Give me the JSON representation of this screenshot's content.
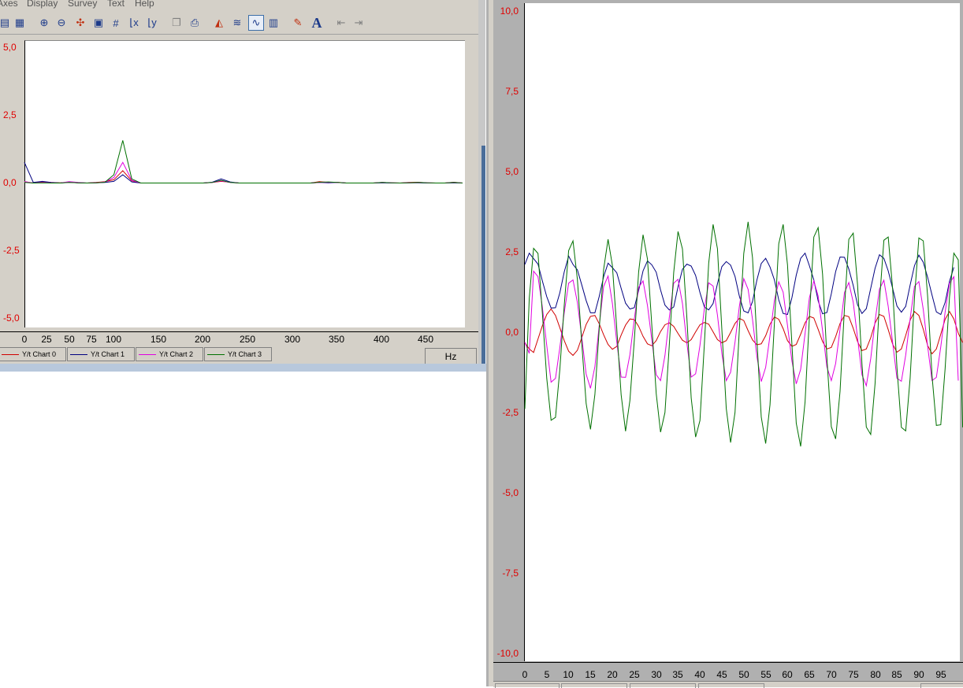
{
  "menu": {
    "items": [
      "Axes",
      "Display",
      "Survey",
      "Text",
      "Help"
    ]
  },
  "toolbar": {
    "icons": [
      "chart-list-icon",
      "table-icon",
      "zoom-in-icon",
      "zoom-out-icon",
      "cursor-icon",
      "save-icon",
      "grid-icon",
      "x-scale-icon",
      "y-scale-icon",
      "copy-icon",
      "print-icon",
      "fill-chart-icon",
      "wave-chart-icon",
      "line-chart-icon",
      "bar-chart-icon",
      "paint-brush-icon",
      "text-icon",
      "arrow-left-icon",
      "arrow-right-icon"
    ],
    "text_glyph": "A"
  },
  "colors": {
    "series0": "#d00000",
    "series1": "#000080",
    "series2": "#e000e0",
    "series3": "#007000",
    "axis_label": "#e00000"
  },
  "legend": [
    {
      "label": "Y/t Chart 0",
      "color": "#d00000"
    },
    {
      "label": "Y/t Chart 1",
      "color": "#000080"
    },
    {
      "label": "Y/t Chart 2",
      "color": "#e000e0"
    },
    {
      "label": "Y/t Chart 3",
      "color": "#007000"
    }
  ],
  "unit_box": "Hz",
  "left_axis": {
    "y_ticks": [
      "5,0",
      "2,5",
      "0,0",
      "-2,5",
      "-5,0"
    ],
    "x_ticks": [
      "0",
      "25",
      "50",
      "75",
      "100",
      "150",
      "200",
      "250",
      "300",
      "350",
      "400",
      "450"
    ]
  },
  "right_axis": {
    "y_ticks": [
      "10,0",
      "7,5",
      "5,0",
      "2,5",
      "0,0",
      "-2,5",
      "-5,0",
      "-7,5",
      "-10,0"
    ],
    "x_ticks": [
      "0",
      "5",
      "10",
      "15",
      "20",
      "25",
      "30",
      "35",
      "40",
      "45",
      "50",
      "55",
      "60",
      "65",
      "70",
      "75",
      "80",
      "85",
      "90",
      "95"
    ]
  },
  "chart_data": [
    {
      "type": "line",
      "xlim": [
        0,
        490
      ],
      "ylim": [
        -5.2,
        5.2
      ],
      "x": [
        0,
        10,
        20,
        30,
        40,
        50,
        60,
        70,
        80,
        90,
        100,
        110,
        120,
        130,
        140,
        150,
        160,
        170,
        180,
        190,
        200,
        210,
        220,
        230,
        240,
        250,
        260,
        270,
        280,
        290,
        300,
        310,
        320,
        330,
        340,
        350,
        360,
        370,
        380,
        390,
        400,
        410,
        420,
        430,
        440,
        450,
        460,
        470,
        480,
        490
      ],
      "series": [
        {
          "name": "Y/t Chart 0",
          "color": "#d00000",
          "values": [
            0.05,
            0.0,
            0.04,
            0.02,
            0.01,
            0.03,
            0.01,
            0.0,
            0.02,
            0.05,
            0.12,
            0.45,
            0.08,
            0.0,
            0.0,
            0.0,
            0.0,
            0.0,
            0.0,
            0.0,
            0.0,
            0.02,
            0.06,
            0.03,
            0.0,
            0.0,
            0.0,
            0.0,
            0.0,
            0.0,
            0.0,
            0.0,
            0.0,
            0.05,
            0.02,
            0.03,
            0.0,
            0.0,
            0.0,
            0.0,
            0.02,
            0.01,
            0.0,
            0.02,
            0.03,
            0.01,
            0.0,
            0.0,
            0.03,
            0.0
          ]
        },
        {
          "name": "Y/t Chart 1",
          "color": "#000080",
          "values": [
            0.75,
            0.02,
            0.06,
            0.02,
            0.0,
            0.03,
            0.01,
            0.0,
            0.01,
            0.02,
            0.06,
            0.3,
            0.04,
            0.0,
            0.0,
            0.0,
            0.0,
            0.0,
            0.0,
            0.0,
            0.0,
            0.03,
            0.15,
            0.04,
            0.0,
            0.0,
            0.0,
            0.0,
            0.0,
            0.0,
            0.0,
            0.0,
            0.0,
            0.02,
            0.01,
            0.02,
            0.0,
            0.0,
            0.0,
            0.0,
            0.01,
            0.0,
            0.0,
            0.01,
            0.01,
            0.0,
            0.0,
            0.0,
            0.01,
            0.0
          ]
        },
        {
          "name": "Y/t Chart 2",
          "color": "#e000e0",
          "values": [
            0.05,
            0.0,
            0.02,
            0.01,
            0.0,
            0.05,
            0.02,
            0.0,
            0.01,
            0.04,
            0.2,
            0.75,
            0.1,
            0.0,
            0.0,
            0.0,
            0.0,
            0.0,
            0.0,
            0.0,
            0.0,
            0.02,
            0.08,
            0.02,
            0.0,
            0.0,
            0.0,
            0.0,
            0.0,
            0.0,
            0.0,
            0.0,
            0.0,
            0.02,
            0.03,
            0.02,
            0.0,
            0.0,
            0.0,
            0.0,
            0.02,
            0.01,
            0.0,
            0.01,
            0.02,
            0.01,
            0.0,
            0.0,
            0.02,
            0.0
          ]
        },
        {
          "name": "Y/t Chart 3",
          "color": "#007000",
          "values": [
            0.02,
            0.0,
            0.01,
            0.0,
            0.0,
            0.02,
            0.01,
            0.0,
            0.01,
            0.03,
            0.3,
            1.55,
            0.15,
            0.0,
            0.0,
            0.0,
            0.0,
            0.0,
            0.0,
            0.0,
            0.0,
            0.02,
            0.1,
            0.02,
            0.0,
            0.0,
            0.0,
            0.0,
            0.0,
            0.0,
            0.0,
            0.0,
            0.0,
            0.03,
            0.04,
            0.02,
            0.0,
            0.0,
            0.0,
            0.0,
            0.02,
            0.01,
            0.0,
            0.01,
            0.02,
            0.01,
            0.0,
            0.0,
            0.02,
            0.0
          ]
        }
      ]
    },
    {
      "type": "line",
      "xlim": [
        0,
        99
      ],
      "ylim": [
        -10.2,
        10.2
      ],
      "x_start": 0,
      "x_step": 1,
      "series": [
        {
          "name": "Y/t Chart 0",
          "color": "#d00000",
          "values": [
            -0.33,
            -0.52,
            -0.63,
            -0.21,
            0.2,
            0.55,
            0.72,
            0.52,
            0.14,
            -0.26,
            -0.59,
            -0.72,
            -0.56,
            -0.17,
            0.24,
            0.49,
            0.52,
            0.26,
            -0.08,
            -0.38,
            -0.53,
            -0.44,
            -0.09,
            0.22,
            0.41,
            0.39,
            0.18,
            -0.13,
            -0.36,
            -0.42,
            -0.26,
            0.02,
            0.23,
            0.29,
            0.18,
            -0.04,
            -0.25,
            -0.33,
            -0.23,
            0.01,
            0.23,
            0.3,
            0.25,
            0.01,
            -0.23,
            -0.33,
            -0.26,
            -0.01,
            0.27,
            0.43,
            0.36,
            0.05,
            -0.24,
            -0.39,
            -0.36,
            -0.11,
            0.25,
            0.47,
            0.4,
            0.11,
            -0.26,
            -0.44,
            -0.38,
            -0.06,
            0.29,
            0.49,
            0.44,
            0.09,
            -0.29,
            -0.52,
            -0.47,
            -0.14,
            0.27,
            0.52,
            0.48,
            0.12,
            -0.29,
            -0.57,
            -0.52,
            -0.17,
            0.28,
            0.55,
            0.49,
            0.08,
            -0.37,
            -0.62,
            -0.52,
            -0.1,
            0.37,
            0.64,
            0.52,
            0.09,
            -0.41,
            -0.67,
            -0.52,
            -0.06,
            0.4,
            0.64,
            0.41,
            -0.03,
            -0.32
          ]
        },
        {
          "name": "Y/t Chart 1",
          "color": "#000080",
          "values": [
            2.1,
            2.45,
            2.28,
            2.11,
            1.59,
            1.1,
            0.75,
            0.76,
            1.22,
            1.87,
            2.36,
            2.1,
            1.93,
            1.47,
            0.98,
            0.6,
            0.6,
            1.11,
            1.72,
            2.14,
            2.0,
            1.84,
            1.36,
            0.9,
            0.72,
            0.76,
            1.29,
            1.9,
            2.21,
            2.09,
            1.86,
            1.31,
            0.84,
            0.69,
            0.78,
            1.41,
            1.95,
            2.11,
            2.05,
            1.76,
            1.23,
            0.78,
            0.69,
            0.89,
            1.5,
            2.03,
            2.19,
            2.08,
            1.73,
            1.12,
            0.66,
            0.6,
            0.95,
            1.61,
            2.13,
            2.29,
            2.02,
            1.62,
            1.0,
            0.58,
            0.55,
            1.07,
            1.77,
            2.29,
            2.45,
            2.06,
            1.62,
            0.97,
            0.57,
            0.61,
            1.19,
            1.88,
            2.33,
            2.32,
            1.96,
            1.45,
            0.85,
            0.58,
            0.73,
            1.36,
            1.98,
            2.4,
            2.29,
            1.9,
            1.36,
            0.81,
            0.62,
            0.8,
            1.46,
            2.06,
            2.39,
            2.17,
            1.7,
            1.15,
            0.63,
            0.55,
            0.92,
            1.58,
            2.01
          ]
        },
        {
          "name": "Y/t Chart 2",
          "color": "#e000e0",
          "values": [
            -0.31,
            -0.66,
            1.89,
            1.72,
            0.78,
            -0.41,
            -1.55,
            -1.43,
            -0.48,
            0.61,
            1.52,
            1.62,
            0.92,
            -0.15,
            -1.3,
            -1.74,
            -1.07,
            0.21,
            1.42,
            1.74,
            0.89,
            -0.31,
            -1.39,
            -1.4,
            -0.7,
            0.4,
            1.39,
            1.59,
            0.83,
            -0.23,
            -1.32,
            -1.5,
            -0.72,
            0.45,
            1.52,
            1.64,
            0.89,
            -0.34,
            -1.39,
            -1.29,
            -0.41,
            0.73,
            1.53,
            1.43,
            0.53,
            -0.66,
            -1.5,
            -1.24,
            -0.31,
            0.8,
            1.66,
            1.33,
            0.4,
            -0.75,
            -1.53,
            -1.09,
            -0.1,
            0.99,
            1.56,
            1.24,
            0.21,
            -0.89,
            -1.6,
            -1.15,
            -0.04,
            1.07,
            1.59,
            1.12,
            0.05,
            -1.08,
            -1.5,
            -0.97,
            0.1,
            1.23,
            1.54,
            0.93,
            -0.18,
            -1.32,
            -1.66,
            -0.82,
            0.34,
            1.34,
            1.61,
            0.8,
            -0.32,
            -1.43,
            -1.52,
            -0.71,
            0.41,
            1.42,
            1.57,
            0.7,
            -0.43,
            -1.5,
            -1.4,
            -0.45,
            0.62,
            1.52,
            1.72,
            -1.5
          ]
        },
        {
          "name": "Y/t Chart 3",
          "color": "#007000",
          "values": [
            -2.38,
            1.05,
            2.6,
            2.44,
            0.6,
            -1.43,
            -2.73,
            -2.64,
            -1.16,
            0.84,
            2.53,
            2.83,
            1.63,
            -0.34,
            -2.21,
            -3.01,
            -1.93,
            0.11,
            1.95,
            2.88,
            2.07,
            0.09,
            -1.94,
            -3.07,
            -2.12,
            -0.25,
            1.87,
            3.02,
            2.27,
            0.22,
            -1.9,
            -3.1,
            -2.49,
            -0.4,
            1.85,
            3.12,
            2.58,
            0.45,
            -2.04,
            -3.25,
            -2.74,
            -0.37,
            2.14,
            3.34,
            2.59,
            0.08,
            -2.37,
            -3.42,
            -2.49,
            0.1,
            2.44,
            3.42,
            2.31,
            -0.2,
            -2.63,
            -3.45,
            -2.25,
            0.29,
            2.74,
            3.34,
            2.09,
            -0.37,
            -2.82,
            -3.54,
            -2.16,
            0.46,
            2.95,
            3.24,
            1.8,
            -0.79,
            -2.93,
            -3.31,
            -1.83,
            0.76,
            2.88,
            3.07,
            1.47,
            -0.98,
            -2.94,
            -3.17,
            -1.6,
            0.94,
            2.85,
            2.95,
            1.35,
            -1.1,
            -2.95,
            -3.06,
            -1.43,
            1.06,
            2.92,
            2.83,
            1.12,
            -1.35,
            -2.89,
            -2.87,
            -1.13,
            1.1,
            2.45,
            2.24,
            -2.95
          ]
        }
      ]
    }
  ]
}
